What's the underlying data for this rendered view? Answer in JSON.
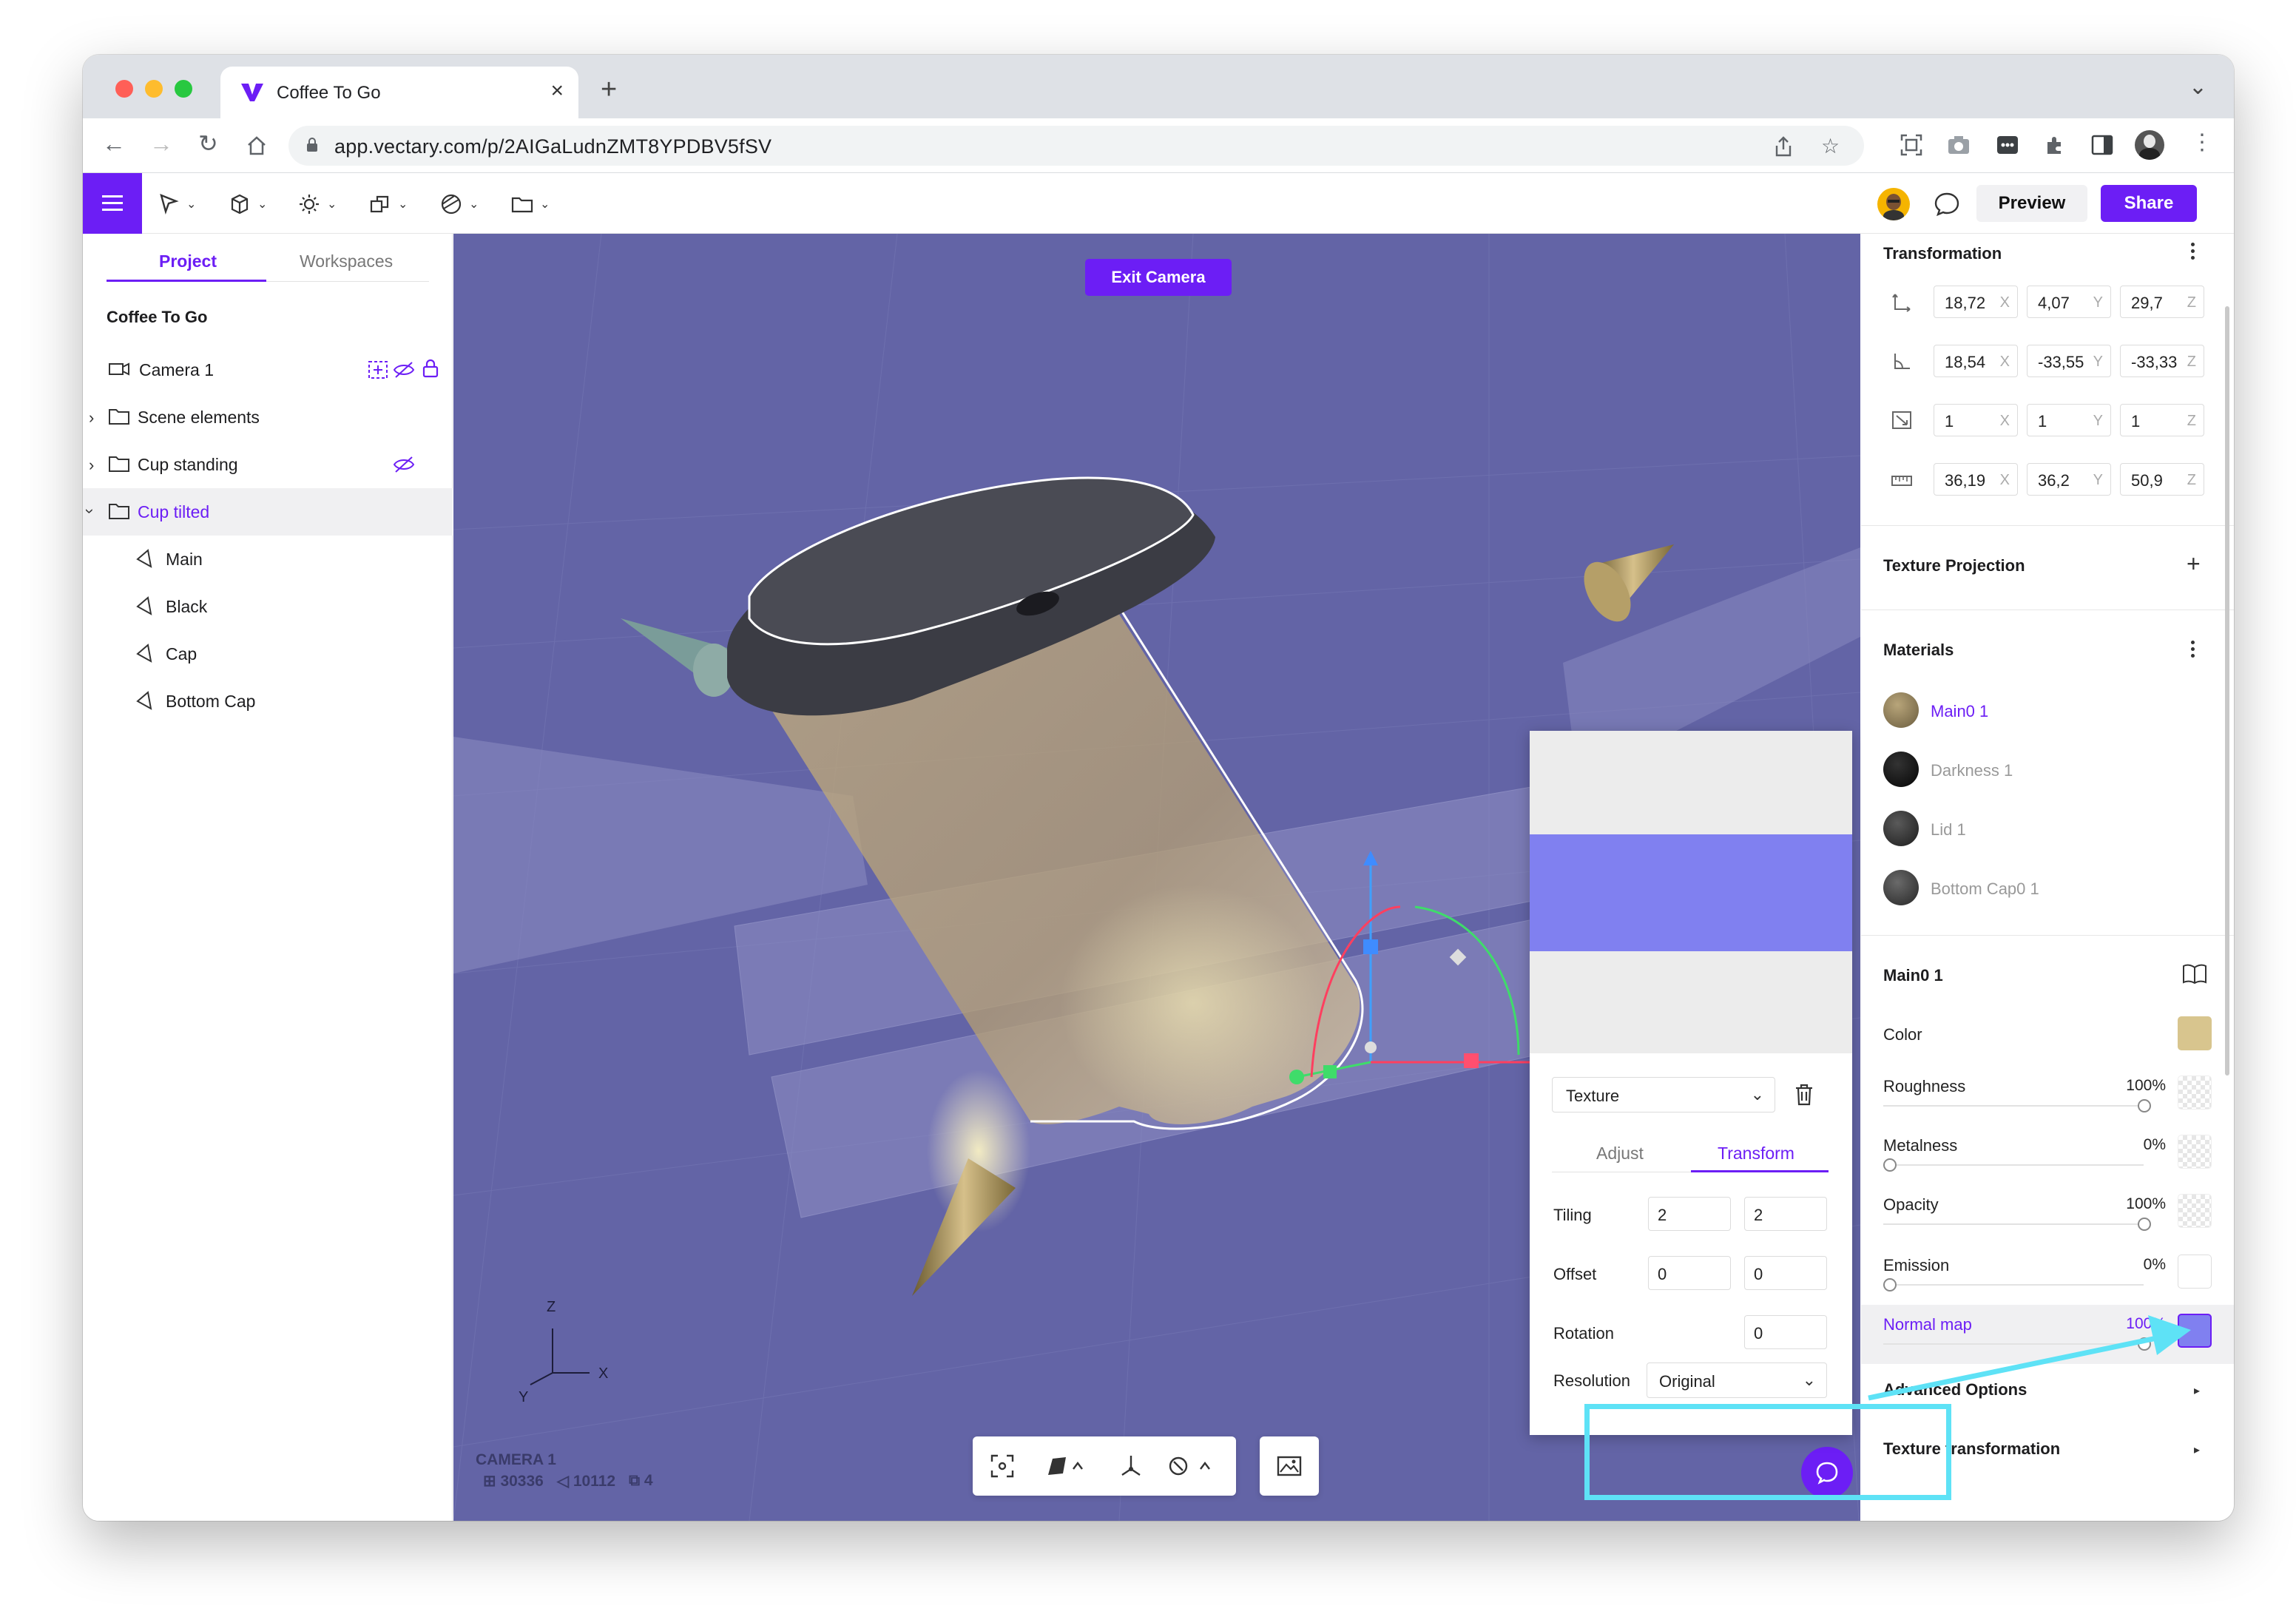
{
  "browser": {
    "tab_title": "Coffee To Go",
    "new_tab": "+",
    "close": "×",
    "url": "app.vectary.com/p/2AIGaLudnZMT8YPDBV5fSV"
  },
  "app": {
    "preview_label": "Preview",
    "share_label": "Share",
    "accent": "#6c1ef5"
  },
  "left": {
    "tabs": [
      {
        "label": "Project"
      },
      {
        "label": "Workspaces"
      }
    ],
    "project_title": "Coffee To Go",
    "tree": [
      {
        "label": "Camera 1",
        "icon": "camera-icon"
      },
      {
        "label": "Scene elements",
        "icon": "folder-icon"
      },
      {
        "label": "Cup standing",
        "icon": "folder-icon"
      },
      {
        "label": "Cup tilted",
        "icon": "folder-icon"
      },
      {
        "label": "Main",
        "icon": "mesh-icon"
      },
      {
        "label": "Black",
        "icon": "mesh-icon"
      },
      {
        "label": "Cap",
        "icon": "mesh-icon"
      },
      {
        "label": "Bottom Cap",
        "icon": "mesh-icon"
      }
    ]
  },
  "viewport": {
    "exit_camera": "Exit Camera",
    "axes": {
      "z": "Z",
      "y": "Y",
      "x": "X"
    },
    "camera_name": "CAMERA 1",
    "stats": {
      "faces": "30336",
      "vertices": "10112",
      "objects": "4"
    },
    "background": "#6364a6"
  },
  "texture_popup": {
    "type_select": "Texture",
    "tabs": [
      {
        "label": "Adjust"
      },
      {
        "label": "Transform"
      }
    ],
    "tiling_label": "Tiling",
    "tiling": [
      "2",
      "2"
    ],
    "offset_label": "Offset",
    "offset": [
      "0",
      "0"
    ],
    "rotation_label": "Rotation",
    "rotation": "0",
    "resolution_label": "Resolution",
    "resolution": "Original"
  },
  "right": {
    "transformation_title": "Transformation",
    "position": {
      "x": "18,72",
      "y": "4,07",
      "z": "29,7"
    },
    "rotation": {
      "x": "18,54",
      "y": "-33,55",
      "z": "-33,33"
    },
    "scale": {
      "x": "1",
      "y": "1",
      "z": "1"
    },
    "dimensions": {
      "x": "36,19",
      "y": "36,2",
      "z": "50,9"
    },
    "axis_labels": {
      "x": "X",
      "y": "Y",
      "z": "Z"
    },
    "texture_projection_title": "Texture Projection",
    "materials_title": "Materials",
    "materials": [
      {
        "label": "Main0 1",
        "color": "#8c7b5c"
      },
      {
        "label": "Darkness 1",
        "color": "#111111"
      },
      {
        "label": "Lid 1",
        "color": "#2e2e2e"
      },
      {
        "label": "Bottom Cap0 1",
        "color": "#3c3c3c"
      }
    ],
    "material_title": "Main0 1",
    "color_label": "Color",
    "color_value": "#d8c58e",
    "roughness_label": "Roughness",
    "roughness": "100%",
    "metalness_label": "Metalness",
    "metalness": "0%",
    "opacity_label": "Opacity",
    "opacity": "100%",
    "emission_label": "Emission",
    "emission": "0%",
    "normal_map_label": "Normal map",
    "normal_map": "100%",
    "advanced_label": "Advanced Options",
    "texture_transformation_label": "Texture transformation"
  },
  "annotation": {
    "color": "#5ee2f6"
  }
}
